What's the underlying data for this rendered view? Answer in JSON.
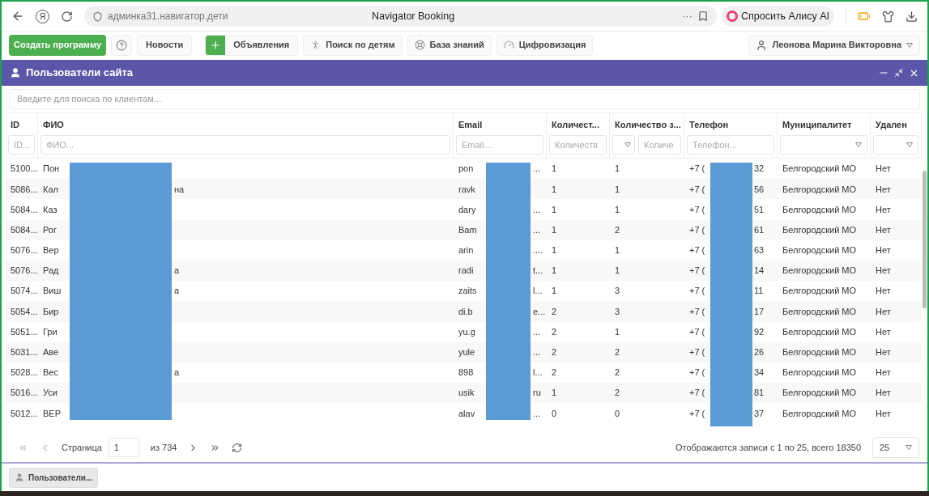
{
  "browser": {
    "logo": "Я",
    "url": "админка31.навигатор.дети",
    "title": "Navigator Booking",
    "more": "···",
    "assistant": "Спросить Алису AI"
  },
  "toolbar": {
    "buttons": [
      {
        "kind": "primary",
        "label": "Создать программу"
      },
      {
        "kind": "icon"
      },
      {
        "kind": "text",
        "label": "Новости"
      },
      {
        "kind": "add",
        "label": "Объявления"
      },
      {
        "kind": "icon-text",
        "label": "Поиск по детям"
      },
      {
        "kind": "icon-text",
        "label": "База знаний"
      },
      {
        "kind": "icon-text",
        "label": "Цифровизация"
      }
    ],
    "user": "Леонова Марина Викторовна"
  },
  "panel": {
    "title": "Пользователи сайта",
    "search_placeholder": "Введите для поиска по клиентам..."
  },
  "table": {
    "columns": [
      {
        "label": "ID",
        "filter": {
          "kind": "text",
          "placeholder": "ID..."
        }
      },
      {
        "label": "ФИО",
        "filter": {
          "kind": "text",
          "placeholder": "ФИО..."
        }
      },
      {
        "label": "Email",
        "filter": {
          "kind": "text",
          "placeholder": "Email..."
        }
      },
      {
        "label": "Количест...",
        "filter": {
          "kind": "text",
          "placeholder": "Количеств"
        }
      },
      {
        "label": "Количество з...",
        "filter": {
          "kind": "select-text",
          "placeholder": "Количе"
        }
      },
      {
        "label": "Телефон",
        "filter": {
          "kind": "text",
          "placeholder": "Телефон..."
        }
      },
      {
        "label": "Муниципалитет",
        "filter": {
          "kind": "select"
        }
      },
      {
        "label": "Удален",
        "filter": {
          "kind": "select"
        }
      }
    ],
    "rows": [
      {
        "id": "5100...",
        "fio": {
          "start": "Пон"
        },
        "email": {
          "start": "pon",
          "end": "..."
        },
        "count_1": "1",
        "count_2": "1",
        "phone": {
          "start": "+7 (",
          "end": "32"
        },
        "municipality": "Белгородский МО",
        "deleted": "Нет"
      },
      {
        "id": "5086...",
        "fio": {
          "start": "Кал",
          "end": "на"
        },
        "email": {
          "start": "ravk"
        },
        "count_1": "1",
        "count_2": "1",
        "phone": {
          "start": "+7 (",
          "end": "56"
        },
        "municipality": "Белгородский МО",
        "deleted": "Нет"
      },
      {
        "id": "5084...",
        "fio": {
          "start": "Каз"
        },
        "email": {
          "start": "dary",
          "end": "..."
        },
        "count_1": "1",
        "count_2": "1",
        "phone": {
          "start": "+7 (",
          "end": "51"
        },
        "municipality": "Белгородский МО",
        "deleted": "Нет"
      },
      {
        "id": "5084...",
        "fio": {
          "start": "Рог"
        },
        "email": {
          "start": "Bam",
          "end": "..."
        },
        "count_1": "1",
        "count_2": "2",
        "phone": {
          "start": "+7 (",
          "end": "61"
        },
        "municipality": "Белгородский МО",
        "deleted": "Нет"
      },
      {
        "id": "5076...",
        "fio": {
          "start": "Вер"
        },
        "email": {
          "start": "arin",
          "end": "...."
        },
        "count_1": "1",
        "count_2": "1",
        "phone": {
          "start": "+7 (",
          "end": "63"
        },
        "municipality": "Белгородский МО",
        "deleted": "Нет"
      },
      {
        "id": "5076...",
        "fio": {
          "start": "Рад",
          "end": "а"
        },
        "email": {
          "start": "radi",
          "end": "t..."
        },
        "count_1": "1",
        "count_2": "1",
        "phone": {
          "start": "+7 (",
          "end": "14"
        },
        "municipality": "Белгородский МО",
        "deleted": "Нет"
      },
      {
        "id": "5074...",
        "fio": {
          "start": "Виш",
          "end": "а"
        },
        "email": {
          "start": "zaits",
          "end": "l..."
        },
        "count_1": "1",
        "count_2": "3",
        "phone": {
          "start": "+7 (",
          "end": "11"
        },
        "municipality": "Белгородский МО",
        "deleted": "Нет"
      },
      {
        "id": "5054...",
        "fio": {
          "start": "Бир"
        },
        "email": {
          "start": "di.b",
          "end": "e..."
        },
        "count_1": "2",
        "count_2": "3",
        "phone": {
          "start": "+7 (",
          "end": "17"
        },
        "municipality": "Белгородский МО",
        "deleted": "Нет"
      },
      {
        "id": "5051...",
        "fio": {
          "start": "Гри"
        },
        "email": {
          "start": "yu.g",
          "end": "..."
        },
        "count_1": "2",
        "count_2": "1",
        "phone": {
          "start": "+7 (",
          "end": "92"
        },
        "municipality": "Белгородский МО",
        "deleted": "Нет"
      },
      {
        "id": "5031...",
        "fio": {
          "start": "Аве"
        },
        "email": {
          "start": "yule",
          "end": "..."
        },
        "count_1": "2",
        "count_2": "2",
        "phone": {
          "start": "+7 (",
          "end": "26"
        },
        "municipality": "Белгородский МО",
        "deleted": "Нет"
      },
      {
        "id": "5028...",
        "fio": {
          "start": "Вес",
          "end": "а"
        },
        "email": {
          "start": "898",
          "end": "l..."
        },
        "count_1": "2",
        "count_2": "2",
        "phone": {
          "start": "+7 (",
          "end": "34"
        },
        "municipality": "Белгородский МО",
        "deleted": "Нет"
      },
      {
        "id": "5016...",
        "fio": {
          "start": "Уси"
        },
        "email": {
          "start": "usik",
          "end": "ru"
        },
        "count_1": "1",
        "count_2": "2",
        "phone": {
          "start": "+7 (",
          "end": "81"
        },
        "municipality": "Белгородский МО",
        "deleted": "Нет"
      },
      {
        "id": "5012...",
        "fio": {
          "start": "ВЕР"
        },
        "email": {
          "start": "alav",
          "end": "..."
        },
        "count_1": "0",
        "count_2": "0",
        "phone": {
          "start": "+7 (",
          "end": "37"
        },
        "municipality": "Белгородский МО",
        "deleted": "Нет"
      }
    ]
  },
  "pager": {
    "page_label": "Страница",
    "page": "1",
    "of": "из 734",
    "info": "Отображаются записи с 1 по 25, всего 18350",
    "per_page": "25"
  },
  "taskbar": [
    {
      "label": "Пользователи..."
    }
  ]
}
